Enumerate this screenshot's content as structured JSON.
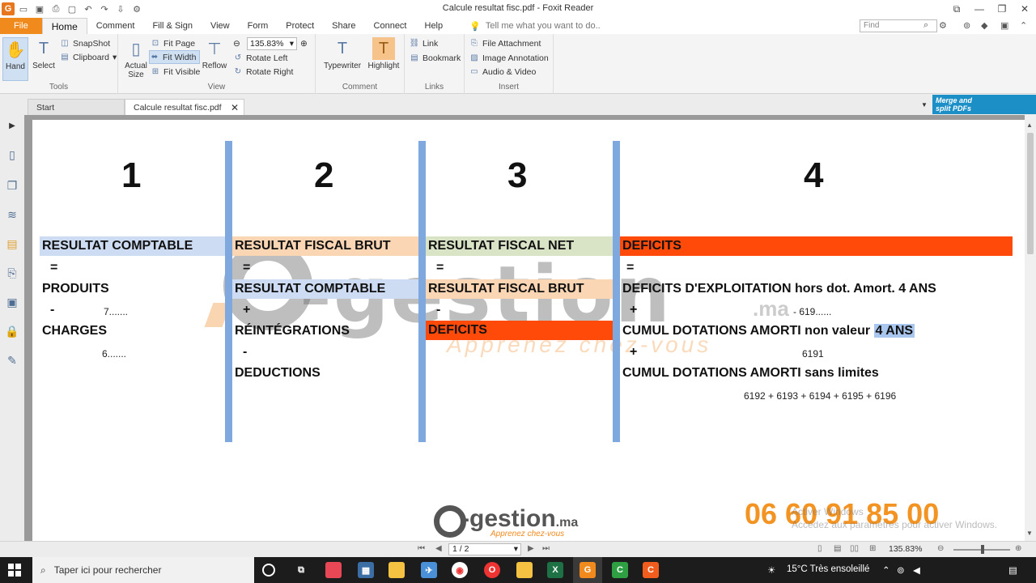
{
  "window": {
    "title": "Calcule resultat fisc.pdf - Foxit Reader"
  },
  "menu": {
    "tabs": [
      "File",
      "Home",
      "Comment",
      "Fill & Sign",
      "View",
      "Form",
      "Protect",
      "Share",
      "Connect",
      "Help"
    ],
    "tell_me": "Tell me what you want to do..",
    "find_placeholder": "Find"
  },
  "ribbon": {
    "tools": {
      "hand": "Hand",
      "select": "Select",
      "snapshot": "SnapShot",
      "clipboard": "Clipboard",
      "label": "Tools"
    },
    "view": {
      "actual_size_1": "Actual",
      "actual_size_2": "Size",
      "fit_page": "Fit Page",
      "fit_width": "Fit Width",
      "fit_visible": "Fit Visible",
      "reflow": "Reflow",
      "zoom": "135.83%",
      "rotate_left": "Rotate Left",
      "rotate_right": "Rotate Right",
      "label": "View"
    },
    "comment": {
      "typewriter": "Typewriter",
      "highlight": "Highlight",
      "label": "Comment"
    },
    "links": {
      "link": "Link",
      "bookmark": "Bookmark",
      "label": "Links"
    },
    "insert": {
      "file_attachment": "File Attachment",
      "image_annotation": "Image Annotation",
      "audio_video": "Audio & Video",
      "label": "Insert"
    }
  },
  "doc_tabs": {
    "start": "Start",
    "file": "Calcule resultat fisc.pdf"
  },
  "ad": {
    "line1": "Merge and",
    "line2": "split PDFs"
  },
  "document": {
    "columns": [
      {
        "number": "1",
        "header": "RESULTAT COMPTABLE",
        "header_color": "#cddcf2",
        "rows": [
          "=",
          "PRODUITS",
          "-",
          "7.......",
          "CHARGES",
          "6......."
        ]
      },
      {
        "number": "2",
        "header": "RESULTAT FISCAL BRUT",
        "header_color": "#fbd6b4",
        "rows": [
          "=",
          "RESULTAT COMPTABLE",
          "+",
          "RÉINTÉGRATIONS",
          "-",
          "DEDUCTIONS"
        ]
      },
      {
        "number": "3",
        "header": "RESULTAT FISCAL NET",
        "header_color": "#d9e3c6",
        "rows": [
          "=",
          "RESULTAT FISCAL BRUT",
          "-",
          "DEFICITS"
        ]
      },
      {
        "number": "4",
        "header": "DEFICITS",
        "header_color": "#ff4a0a",
        "rows": [
          "=",
          "DEFICITS D'EXPLOITATION hors dot. Amort. 4 ANS",
          "+",
          "- 619......",
          "CUMUL DOTATIONS AMORTI non valeur",
          "4 ANS",
          "+",
          "6191",
          "CUMUL DOTATIONS AMORTI  sans limites",
          "6192 + 6193 + 6194 + 6195 + 6196"
        ]
      }
    ],
    "watermark": {
      "text": "-gestion",
      "ma": ".ma",
      "tagline": "Apprenez chez-vous"
    },
    "footer": {
      "logo": "-gestion",
      "logo_ma": ".ma",
      "logo_tag": "Apprenez chez-vous",
      "phone": "06 60 91 85 00",
      "activate_1": "Activer Windows",
      "activate_2": "Accédez aux paramètres pour activer Windows."
    }
  },
  "statusbar": {
    "page": "1 / 2",
    "zoom": "135.83%"
  },
  "taskbar": {
    "search_placeholder": "Taper ici pour rechercher",
    "weather": "15°C  Très ensoleillé"
  },
  "colors": {
    "accent": "#f08a1c",
    "deficit": "#ff4a0a",
    "column_line": "#7fa8df",
    "phone": "#f39322"
  }
}
